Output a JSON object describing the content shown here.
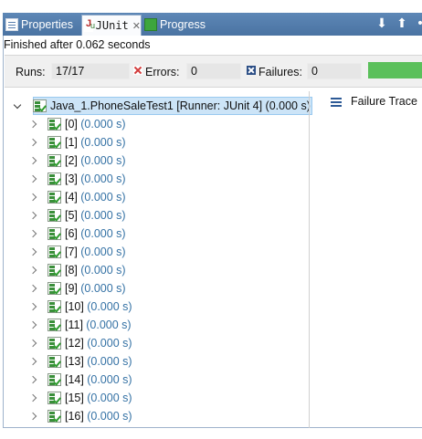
{
  "tabs": {
    "properties": "Properties",
    "junit": "JUnit",
    "progress": "Progress"
  },
  "status": "Finished after 0.062 seconds",
  "counters": {
    "runs_label": "Runs:",
    "runs_value": "17/17",
    "errors_label": "Errors:",
    "errors_value": "0",
    "failures_label": "Failures:",
    "failures_value": "0"
  },
  "progress_fraction": 1.0,
  "colors": {
    "success_bar": "#5bc05b",
    "time_text": "#3572a5",
    "selection": "#cce4f7",
    "tab_bar": "#5d87b6"
  },
  "tree": {
    "root": {
      "label": "Java_1.PhoneSaleTest1 [Runner: JUnit 4] (0.000 s)"
    },
    "items": [
      {
        "label": "[0]",
        "time": "(0.000 s)"
      },
      {
        "label": "[1]",
        "time": "(0.000 s)"
      },
      {
        "label": "[2]",
        "time": "(0.000 s)"
      },
      {
        "label": "[3]",
        "time": "(0.000 s)"
      },
      {
        "label": "[4]",
        "time": "(0.000 s)"
      },
      {
        "label": "[5]",
        "time": "(0.000 s)"
      },
      {
        "label": "[6]",
        "time": "(0.000 s)"
      },
      {
        "label": "[7]",
        "time": "(0.000 s)"
      },
      {
        "label": "[8]",
        "time": "(0.000 s)"
      },
      {
        "label": "[9]",
        "time": "(0.000 s)"
      },
      {
        "label": "[10]",
        "time": "(0.000 s)"
      },
      {
        "label": "[11]",
        "time": "(0.000 s)"
      },
      {
        "label": "[12]",
        "time": "(0.000 s)"
      },
      {
        "label": "[13]",
        "time": "(0.000 s)"
      },
      {
        "label": "[14]",
        "time": "(0.000 s)"
      },
      {
        "label": "[15]",
        "time": "(0.000 s)"
      },
      {
        "label": "[16]",
        "time": "(0.000 s)"
      }
    ]
  },
  "failure_trace": {
    "label": "Failure Trace"
  }
}
